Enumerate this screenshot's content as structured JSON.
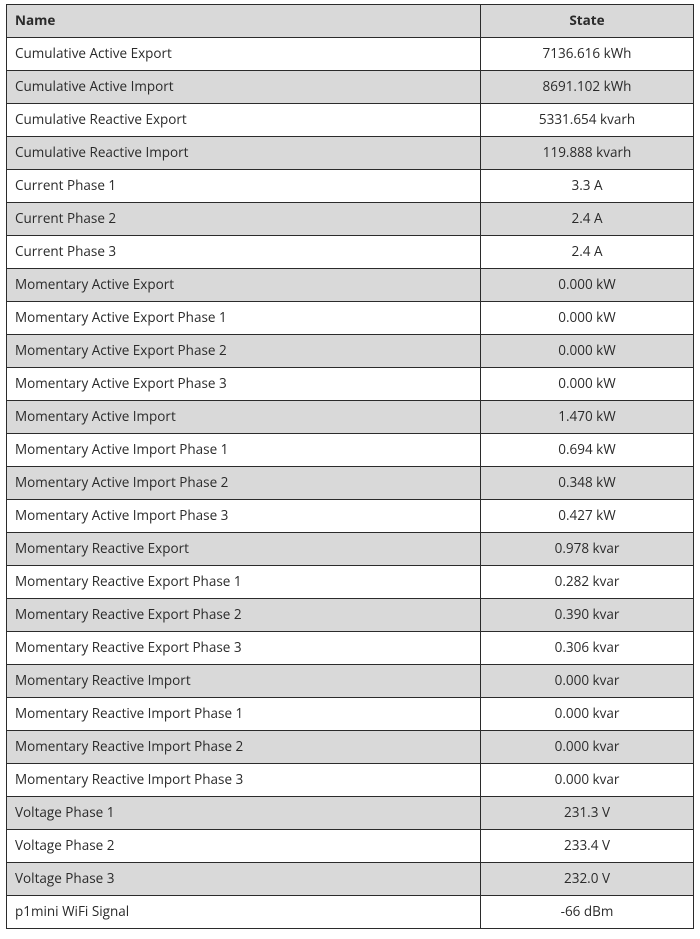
{
  "columns": {
    "name": "Name",
    "state": "State"
  },
  "rows": [
    {
      "name": "Cumulative Active Export",
      "state": "7136.616 kWh"
    },
    {
      "name": "Cumulative Active Import",
      "state": "8691.102 kWh"
    },
    {
      "name": "Cumulative Reactive Export",
      "state": "5331.654 kvarh"
    },
    {
      "name": "Cumulative Reactive Import",
      "state": "119.888 kvarh"
    },
    {
      "name": "Current Phase 1",
      "state": "3.3 A"
    },
    {
      "name": "Current Phase 2",
      "state": "2.4 A"
    },
    {
      "name": "Current Phase 3",
      "state": "2.4 A"
    },
    {
      "name": "Momentary Active Export",
      "state": "0.000 kW"
    },
    {
      "name": "Momentary Active Export Phase 1",
      "state": "0.000 kW"
    },
    {
      "name": "Momentary Active Export Phase 2",
      "state": "0.000 kW"
    },
    {
      "name": "Momentary Active Export Phase 3",
      "state": "0.000 kW"
    },
    {
      "name": "Momentary Active Import",
      "state": "1.470 kW"
    },
    {
      "name": "Momentary Active Import Phase 1",
      "state": "0.694 kW"
    },
    {
      "name": "Momentary Active Import Phase 2",
      "state": "0.348 kW"
    },
    {
      "name": "Momentary Active Import Phase 3",
      "state": "0.427 kW"
    },
    {
      "name": "Momentary Reactive Export",
      "state": "0.978 kvar"
    },
    {
      "name": "Momentary Reactive Export Phase 1",
      "state": "0.282 kvar"
    },
    {
      "name": "Momentary Reactive Export Phase 2",
      "state": "0.390 kvar"
    },
    {
      "name": "Momentary Reactive Export Phase 3",
      "state": "0.306 kvar"
    },
    {
      "name": "Momentary Reactive Import",
      "state": "0.000 kvar"
    },
    {
      "name": "Momentary Reactive Import Phase 1",
      "state": "0.000 kvar"
    },
    {
      "name": "Momentary Reactive Import Phase 2",
      "state": "0.000 kvar"
    },
    {
      "name": "Momentary Reactive Import Phase 3",
      "state": "0.000 kvar"
    },
    {
      "name": "Voltage Phase 1",
      "state": "231.3 V"
    },
    {
      "name": "Voltage Phase 2",
      "state": "233.4 V"
    },
    {
      "name": "Voltage Phase 3",
      "state": "232.0 V"
    },
    {
      "name": "p1mini WiFi Signal",
      "state": "-66 dBm"
    }
  ]
}
